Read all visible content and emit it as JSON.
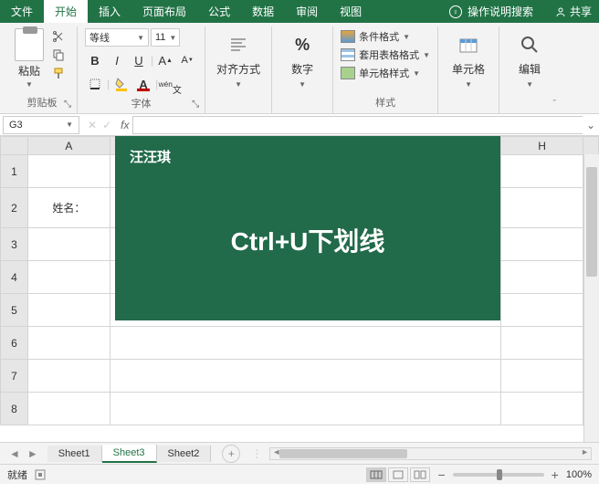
{
  "tabs": {
    "file": "文件",
    "home": "开始",
    "insert": "插入",
    "layout": "页面布局",
    "formula": "公式",
    "data": "数据",
    "review": "审阅",
    "view": "视图",
    "tell_me": "操作说明搜索",
    "share": "共享"
  },
  "ribbon": {
    "clipboard": {
      "label": "剪贴板",
      "paste": "粘贴"
    },
    "font": {
      "label": "字体",
      "name": "等线",
      "size": "11"
    },
    "align": {
      "label": "对齐方式"
    },
    "number": {
      "label": "数字",
      "percent": "%"
    },
    "styles": {
      "label": "样式",
      "cond": "条件格式",
      "table": "套用表格格式",
      "cell": "单元格样式"
    },
    "cells": {
      "label": "单元格"
    },
    "editing": {
      "label": "编辑"
    }
  },
  "formula_bar": {
    "cell_ref": "G3",
    "fx": "fx"
  },
  "sheet": {
    "cols": [
      "A",
      "H"
    ],
    "row_labels": [
      "1",
      "2",
      "3",
      "4",
      "5",
      "6",
      "7",
      "8"
    ],
    "cell_a2": "姓名："
  },
  "overlay": {
    "brand": "汪汪琪",
    "text": "Ctrl+U下划线"
  },
  "tabs_bottom": {
    "s1": "Sheet1",
    "s2": "Sheet3",
    "s3": "Sheet2"
  },
  "status": {
    "ready": "就绪",
    "zoom": "100%"
  }
}
